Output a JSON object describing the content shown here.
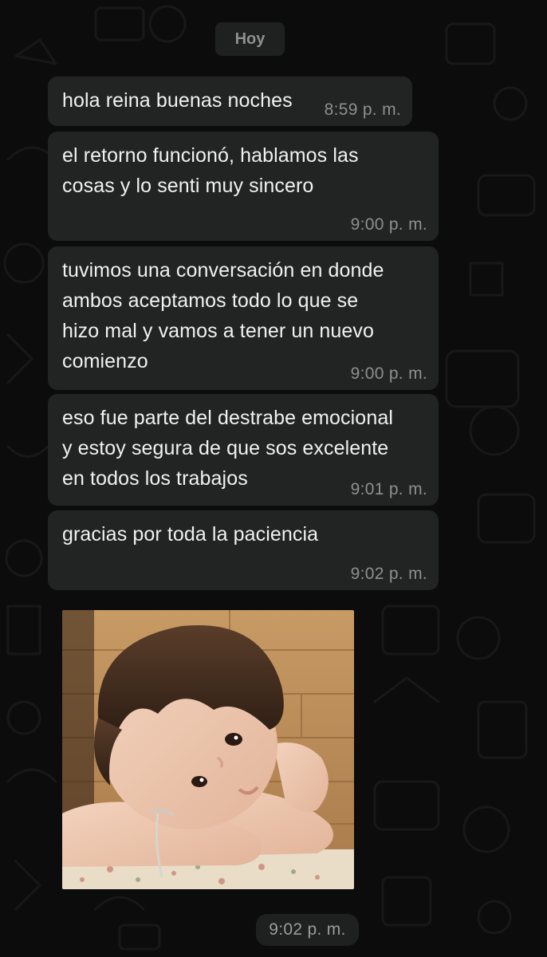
{
  "chat": {
    "day_label": "Hoy",
    "messages": [
      {
        "text": "hola reina buenas noches",
        "time": "8:59 p. m."
      },
      {
        "text": "el retorno funcionó, hablamos las\ncosas y lo senti muy sincero",
        "time": "9:00 p. m."
      },
      {
        "text": "tuvimos una conversación en donde\nambos aceptamos todo lo que se\nhizo mal y vamos a tener un nuevo\ncomienzo",
        "time": "9:00 p. m."
      },
      {
        "text": "eso fue parte del destrabe emocional\ny estoy segura de que sos excelente\nen todos los trabajos",
        "time": "9:01 p. m."
      },
      {
        "text": "gracias por toda la paciencia",
        "time": "9:02 p. m."
      }
    ],
    "image_message": {
      "time": "9:02 p. m."
    }
  },
  "colors": {
    "background": "#0c0c0c",
    "bubble": "#222323",
    "text": "#f1f1f1",
    "timestamp": "#8e8f90"
  }
}
